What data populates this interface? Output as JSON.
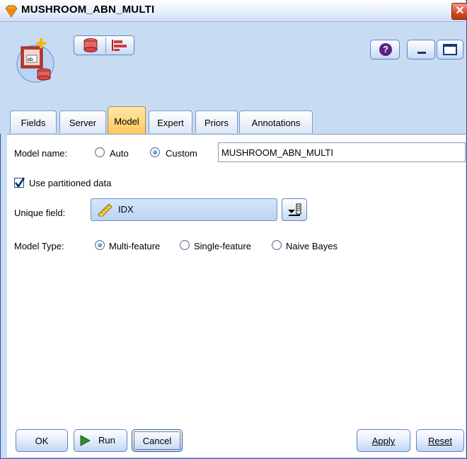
{
  "window": {
    "title": "MUSHROOM_ABN_MULTI",
    "close_glyph": "✕"
  },
  "toolbar": {
    "buttons": [
      {
        "icon": "database-icon"
      },
      {
        "icon": "bar-chart-icon"
      }
    ],
    "help_icon": "help-icon",
    "help_glyph": "?",
    "minimize_icon": "minimize-icon",
    "maximize_icon": "maximize-icon"
  },
  "tabs": [
    "Fields",
    "Server",
    "Model",
    "Expert",
    "Priors",
    "Annotations"
  ],
  "active_tab": "Model",
  "form": {
    "model_name_label": "Model name:",
    "auto_label": "Auto",
    "custom_label": "Custom",
    "model_name_selected": "Custom",
    "model_name_value": "MUSHROOM_ABN_MULTI",
    "use_partitioned_label": "Use partitioned data",
    "use_partitioned_checked": true,
    "unique_field_label": "Unique field:",
    "unique_field_value": "IDX",
    "model_type_label": "Model Type:",
    "model_type_options": [
      "Multi-feature",
      "Single-feature",
      "Naive Bayes"
    ],
    "model_type_selected": "Multi-feature"
  },
  "buttons": {
    "ok": "OK",
    "run": "Run",
    "cancel": "Cancel",
    "apply": "Apply",
    "reset": "Reset"
  },
  "colors": {
    "accent": "#ffc85b",
    "frame": "#c7dbf3",
    "run_arrow": "#2e8b2e"
  }
}
